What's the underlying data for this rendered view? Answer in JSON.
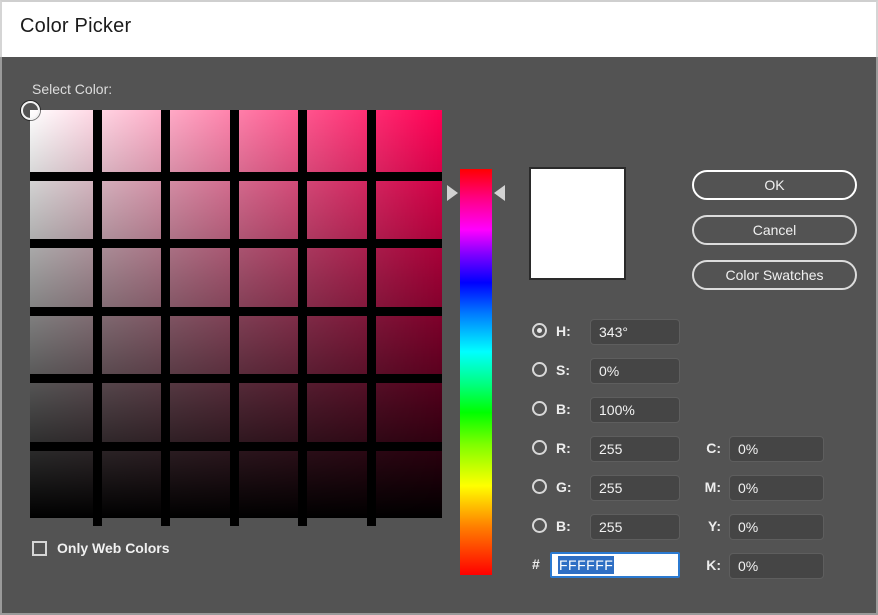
{
  "window": {
    "title": "Color Picker"
  },
  "main": {
    "select_color_label": "Select Color:"
  },
  "buttons": {
    "ok": "OK",
    "cancel": "Cancel",
    "color_swatches": "Color Swatches"
  },
  "hsb": [
    {
      "label": "H:",
      "value": "343°",
      "selected": true
    },
    {
      "label": "S:",
      "value": "0%",
      "selected": false
    },
    {
      "label": "B:",
      "value": "100%",
      "selected": false
    },
    {
      "label": "R:",
      "value": "255",
      "selected": false
    },
    {
      "label": "G:",
      "value": "255",
      "selected": false
    },
    {
      "label": "B:",
      "value": "255",
      "selected": false
    }
  ],
  "cmyk": [
    {
      "label": "C:",
      "value": "0%"
    },
    {
      "label": "M:",
      "value": "0%"
    },
    {
      "label": "Y:",
      "value": "0%"
    },
    {
      "label": "K:",
      "value": "0%"
    }
  ],
  "hex": {
    "prefix": "#",
    "value": "FFFFFF"
  },
  "web_colors": {
    "label": "Only Web Colors",
    "checked": false
  },
  "preview": {
    "color": "#FFFFFF"
  },
  "colors": {
    "dialog_background": "#535353",
    "titlebar_background": "#FFFFFF",
    "field_hue": "#FF0055",
    "input_background": "#454545",
    "accent_focus": "#2B7AD1",
    "selection_highlight": "#2F6FC4"
  }
}
